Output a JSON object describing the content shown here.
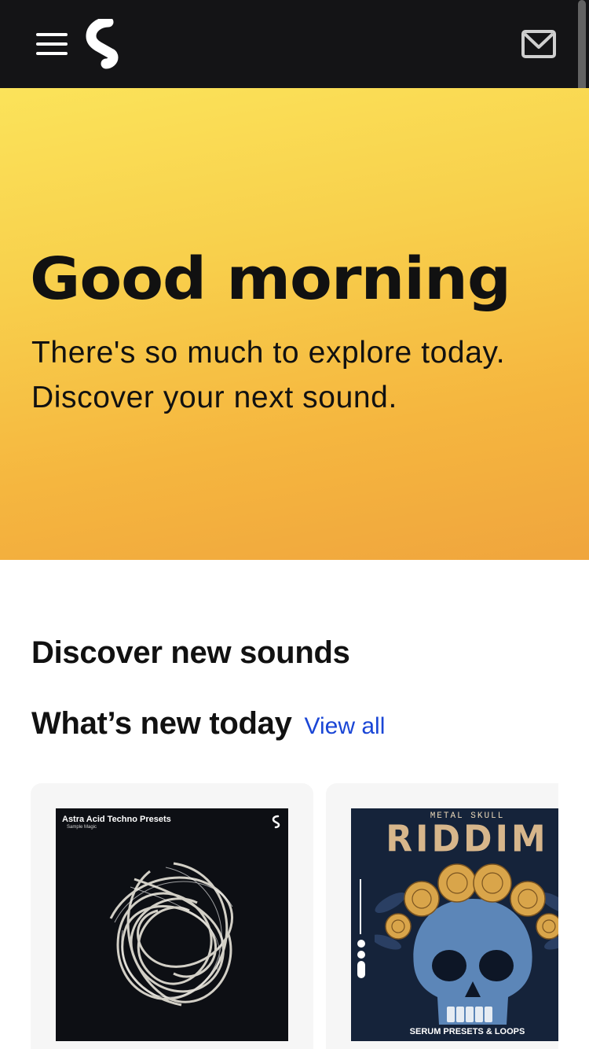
{
  "header": {
    "menu_icon": "hamburger-menu-icon",
    "logo_icon": "splice-logo-icon",
    "mail_icon": "mail-envelope-icon",
    "bg_color": "#141416"
  },
  "hero": {
    "title": "Good morning",
    "subtitle": "There's so much to explore today. Discover your next sound.",
    "gradient_colors": [
      "#fbe35a",
      "#f0a53d"
    ]
  },
  "main": {
    "section_title": "Discover new sounds",
    "row_title": "What’s new today",
    "view_all_label": "View all",
    "link_color": "#1a46d6",
    "cards": [
      {
        "cover_title": "Astra Acid Techno Presets",
        "cover_label": "Sample Magic"
      },
      {
        "cover_top": "METAL SKULL",
        "cover_big": "RIDDIM",
        "cover_bottom": "SERUM PRESETS & LOOPS"
      }
    ]
  }
}
